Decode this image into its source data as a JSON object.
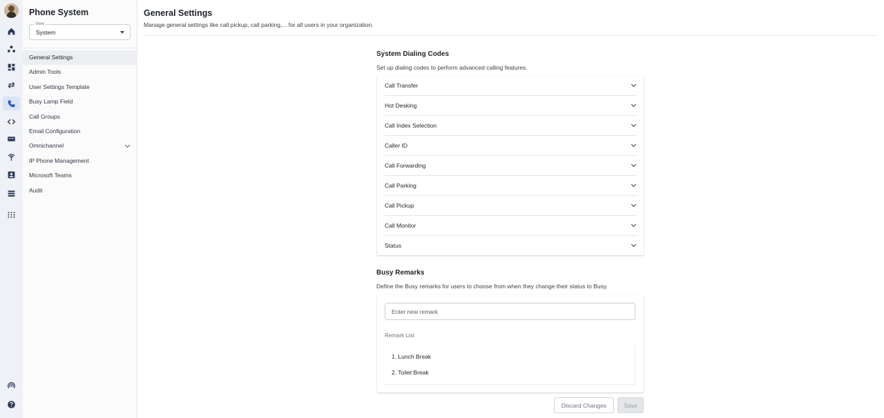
{
  "rail": {
    "icons": [
      "home-icon",
      "people-icon",
      "dashboard-icon",
      "transfer-icon",
      "phone-icon",
      "code-icon",
      "caller-id-icon",
      "broadcast-icon",
      "contact-icon",
      "server-icon",
      "apps-grid-icon",
      "radio-icon",
      "help-icon"
    ],
    "active": "phone-icon"
  },
  "sidebar": {
    "title": "Phone System",
    "view": {
      "legend": "View",
      "value": "System"
    },
    "items": [
      {
        "label": "General Settings",
        "active": true
      },
      {
        "label": "Admin Tools"
      },
      {
        "label": "User Settings Template"
      },
      {
        "label": "Busy Lamp Field"
      },
      {
        "label": "Call Groups"
      },
      {
        "label": "Email Configuration"
      },
      {
        "label": "Omnichannel",
        "expandable": true
      },
      {
        "label": "IP Phone Management"
      },
      {
        "label": "Microsoft Teams"
      },
      {
        "label": "Audit"
      }
    ]
  },
  "header": {
    "title": "General Settings",
    "subtitle": "Manage general settings like call pickup, call parking,... for all users in your organization."
  },
  "dialing": {
    "title": "System Dialing Codes",
    "description": "Set up dialing codes to perform advanced calling features.",
    "items": [
      "Call Transfer",
      "Hot Desking",
      "Call Index Selection",
      "Caller ID",
      "Call Forwarding",
      "Call Parking",
      "Call Pickup",
      "Call Monitor",
      "Status"
    ]
  },
  "remarks": {
    "title": "Busy Remarks",
    "description": "Define the Busy remarks for users to choose from when they change their status to Busy.",
    "input_placeholder": "Enter new remark",
    "list_label": "Remark List",
    "items": [
      "1. Lunch Break",
      "2. Toilet Break"
    ]
  },
  "footer": {
    "discard_label": "Discard Changes",
    "save_label": "Save"
  },
  "colors": {
    "accent": "#1c56c9",
    "rail_bg": "#eef1f6",
    "sidebar_bg": "#fbfbfc"
  }
}
